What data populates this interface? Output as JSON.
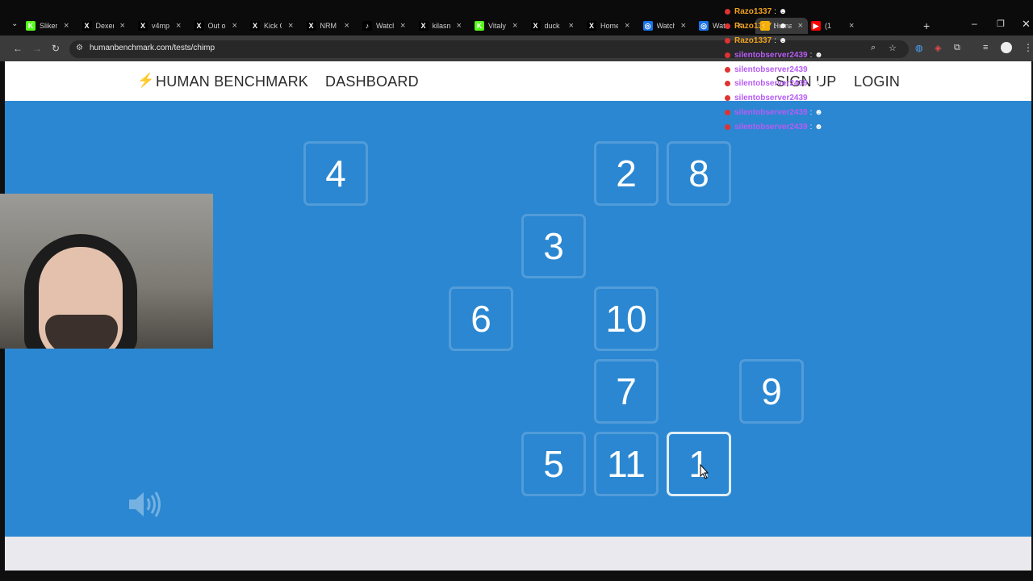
{
  "browser": {
    "tabs": [
      {
        "title": "Sliker",
        "icon": "K",
        "color": "#53fc18",
        "active": false
      },
      {
        "title": "Dexer",
        "icon": "X",
        "color": "#000000",
        "active": false
      },
      {
        "title": "v4mp",
        "icon": "X",
        "color": "#000000",
        "active": false
      },
      {
        "title": "Out o",
        "icon": "X",
        "color": "#000000",
        "active": false
      },
      {
        "title": "Kick C",
        "icon": "X",
        "color": "#000000",
        "active": false
      },
      {
        "title": "NRM",
        "icon": "X",
        "color": "#000000",
        "active": false
      },
      {
        "title": "Watch",
        "icon": "♪",
        "color": "#000000",
        "active": false
      },
      {
        "title": "kilasn",
        "icon": "X",
        "color": "#000000",
        "active": false
      },
      {
        "title": "Vitaly",
        "icon": "K",
        "color": "#53fc18",
        "active": false
      },
      {
        "title": "duck",
        "icon": "X",
        "color": "#000000",
        "active": false
      },
      {
        "title": "Home",
        "icon": "X",
        "color": "#000000",
        "active": false
      },
      {
        "title": "Watch",
        "icon": "◎",
        "color": "#1a73e8",
        "active": false
      },
      {
        "title": "Wat",
        "icon": "◎",
        "color": "#1a73e8",
        "active": false
      },
      {
        "title": "Huma",
        "icon": "⚡",
        "color": "#f5b400",
        "active": true
      },
      {
        "title": "(1",
        "icon": "▶",
        "color": "#ff0000",
        "active": false
      }
    ],
    "url": "humanbenchmark.com/tests/chimp"
  },
  "site": {
    "brand": "HUMAN BENCHMARK",
    "dashboard": "DASHBOARD",
    "signup": "SIGN UP",
    "login": "LOGIN"
  },
  "game": {
    "cells": [
      {
        "label": "4",
        "row": 0,
        "col": 0,
        "active": false
      },
      {
        "label": "2",
        "row": 0,
        "col": 4,
        "active": false
      },
      {
        "label": "8",
        "row": 0,
        "col": 5,
        "active": false
      },
      {
        "label": "3",
        "row": 1,
        "col": 3,
        "active": false
      },
      {
        "label": "6",
        "row": 2,
        "col": 2,
        "active": false
      },
      {
        "label": "10",
        "row": 2,
        "col": 4,
        "active": false
      },
      {
        "label": "7",
        "row": 3,
        "col": 4,
        "active": false
      },
      {
        "label": "9",
        "row": 3,
        "col": 6,
        "active": false
      },
      {
        "label": "5",
        "row": 4,
        "col": 3,
        "active": false
      },
      {
        "label": "11",
        "row": 4,
        "col": 4,
        "active": false
      },
      {
        "label": "1",
        "row": 4,
        "col": 5,
        "active": true
      }
    ]
  },
  "chat": [
    {
      "user": "Razo1337",
      "color": "#f0a21b"
    },
    {
      "user": "Razo1337",
      "color": "#f0a21b"
    },
    {
      "user": "Razo1337",
      "color": "#f0a21b"
    },
    {
      "user": "silentobserver2439",
      "color": "#b75cf5"
    },
    {
      "user": "silentobserver2439",
      "color": "#b75cf5"
    },
    {
      "user": "silentobserver2439",
      "color": "#b75cf5"
    },
    {
      "user": "silentobserver2439",
      "color": "#b75cf5"
    },
    {
      "user": "silentobserver2439",
      "color": "#b75cf5"
    },
    {
      "user": "silentobserver2439",
      "color": "#b75cf5"
    }
  ]
}
